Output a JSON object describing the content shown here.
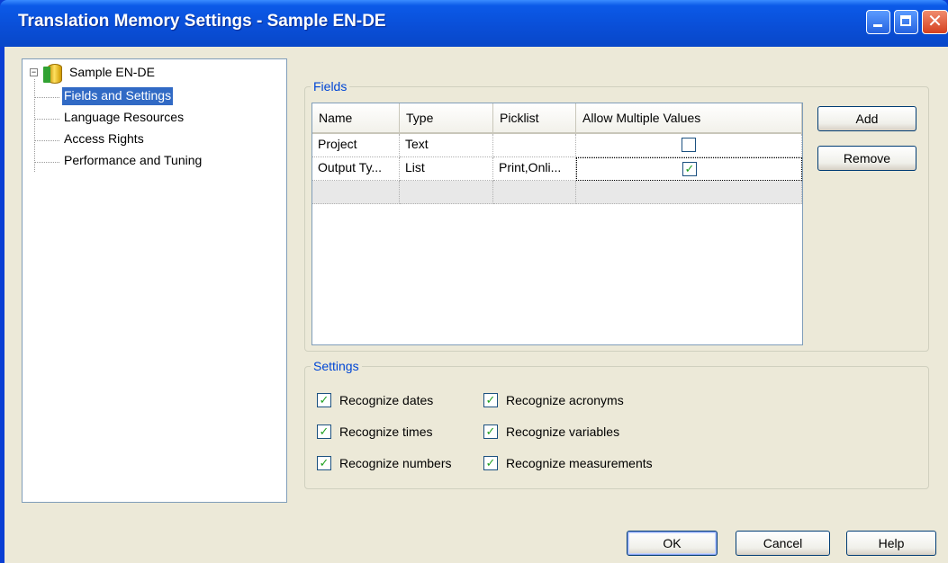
{
  "window": {
    "title": "Translation Memory Settings - Sample EN-DE",
    "min_glyph": "",
    "close_glyph": "✕"
  },
  "tree": {
    "root": {
      "label": "Sample EN-DE",
      "expander": "−",
      "icon": "database-icon"
    },
    "items": [
      {
        "label": "Fields and Settings",
        "selected": true
      },
      {
        "label": "Language Resources"
      },
      {
        "label": "Access Rights"
      },
      {
        "label": "Performance and Tuning"
      }
    ]
  },
  "fields": {
    "legend": "Fields",
    "columns": [
      "Name",
      "Type",
      "Picklist",
      "Allow Multiple Values"
    ],
    "rows": [
      {
        "name": "Project",
        "type": "Text",
        "picklist": "",
        "allow_multiple": false
      },
      {
        "name": "Output Ty...",
        "type": "List",
        "picklist": "Print,Onli...",
        "allow_multiple": true
      }
    ],
    "add_label": "Add",
    "remove_label": "Remove"
  },
  "settings": {
    "legend": "Settings",
    "left": [
      {
        "label": "Recognize dates",
        "checked": true
      },
      {
        "label": "Recognize times",
        "checked": true
      },
      {
        "label": "Recognize numbers",
        "checked": true
      }
    ],
    "right": [
      {
        "label": "Recognize acronyms",
        "checked": true
      },
      {
        "label": "Recognize variables",
        "checked": true
      },
      {
        "label": "Recognize measurements",
        "checked": true
      }
    ]
  },
  "footer": {
    "ok_label": "OK",
    "cancel_label": "Cancel",
    "help_label": "Help"
  },
  "check_mark": "✓",
  "colors": {
    "title_bar": "#0A4FD8",
    "selection": "#316AC5",
    "legend": "#0046D5",
    "dialog": "#ECE9D8"
  }
}
